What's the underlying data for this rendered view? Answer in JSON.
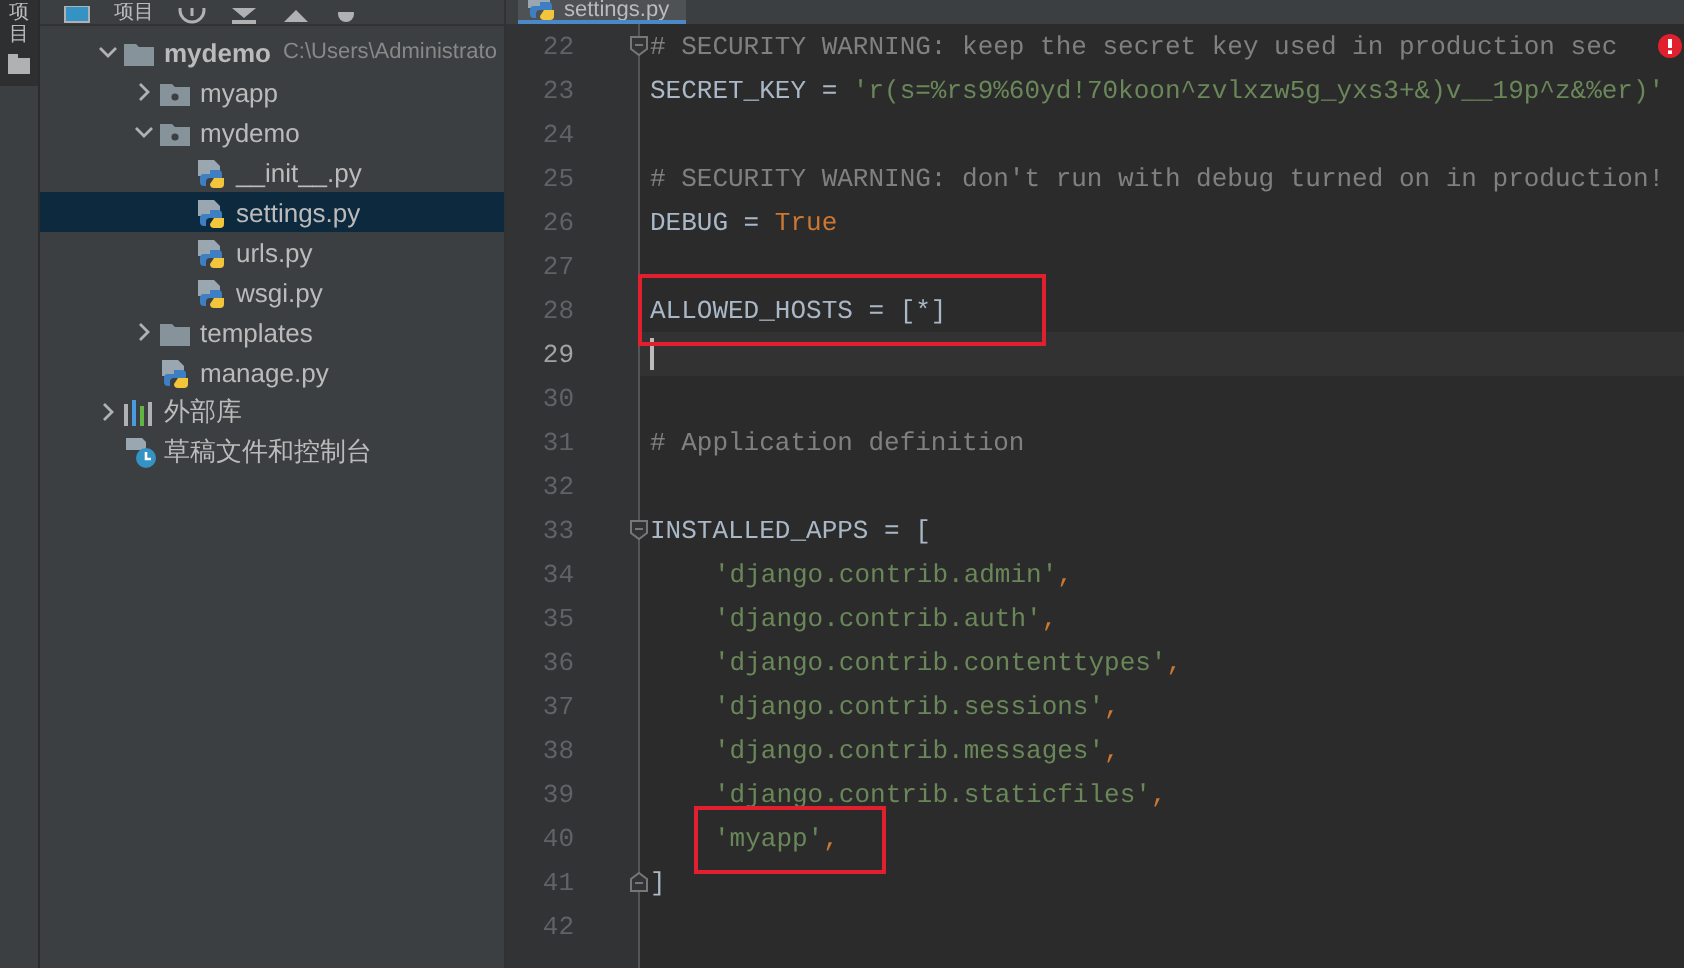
{
  "side_strip": {
    "label": "项目"
  },
  "project_panel": {
    "toolbar": {
      "title": "项目"
    },
    "tree": [
      {
        "label": "mydemo",
        "path": "C:\\Users\\Administrato",
        "kind": "folder",
        "expanded": true,
        "selected": false,
        "children": [
          {
            "label": "myapp",
            "kind": "package",
            "expanded": false,
            "selected": false
          },
          {
            "label": "mydemo",
            "kind": "package",
            "expanded": true,
            "selected": false,
            "children": [
              {
                "label": "__init__.py",
                "kind": "python",
                "selected": false
              },
              {
                "label": "settings.py",
                "kind": "python",
                "selected": true
              },
              {
                "label": "urls.py",
                "kind": "python",
                "selected": false
              },
              {
                "label": "wsgi.py",
                "kind": "python",
                "selected": false
              }
            ]
          },
          {
            "label": "templates",
            "kind": "folder",
            "expanded": false,
            "selected": false
          },
          {
            "label": "manage.py",
            "kind": "python",
            "selected": false
          }
        ]
      },
      {
        "label": "外部库",
        "kind": "library",
        "expanded": false,
        "selected": false
      },
      {
        "label": "草稿文件和控制台",
        "kind": "scratch",
        "selected": false
      }
    ]
  },
  "editor": {
    "tabs": [
      {
        "label": "settings.py",
        "selected": true
      }
    ],
    "lines": [
      {
        "number": "22",
        "fold_open": true,
        "warning": true,
        "tokens": [
          {
            "kind": "comment",
            "text": "# SECURITY WARNING: keep the secret key used in production sec"
          }
        ]
      },
      {
        "number": "23",
        "tokens": [
          {
            "kind": "plain",
            "text": "SECRET_KEY = "
          },
          {
            "kind": "string",
            "text": "'r(s=%rs9%60yd!70koon^zvlxzw5g_yxs3+&)v__19p^z&%er)'"
          }
        ]
      },
      {
        "number": "24"
      },
      {
        "number": "25",
        "tokens": [
          {
            "kind": "comment",
            "text": "# SECURITY WARNING: don't run with debug turned on in production!"
          }
        ]
      },
      {
        "number": "26",
        "tokens": [
          {
            "kind": "plain",
            "text": "DEBUG = "
          },
          {
            "kind": "keyword",
            "text": "True"
          }
        ]
      },
      {
        "number": "27"
      },
      {
        "number": "28",
        "boxed": true,
        "tokens": [
          {
            "kind": "plain",
            "text": "ALLOWED_HOSTS = [*]"
          }
        ]
      },
      {
        "number": "29",
        "current": true
      },
      {
        "number": "30"
      },
      {
        "number": "31",
        "tokens": [
          {
            "kind": "comment",
            "text": "# Application definition"
          }
        ]
      },
      {
        "number": "32"
      },
      {
        "number": "33",
        "fold_open": true,
        "tokens": [
          {
            "kind": "plain",
            "text": "INSTALLED_APPS = ["
          }
        ]
      },
      {
        "number": "34",
        "indented": true,
        "tokens": [
          {
            "kind": "string",
            "text": "'django.contrib.admin'"
          },
          {
            "kind": "punct",
            "text": ","
          }
        ]
      },
      {
        "number": "35",
        "indented": true,
        "tokens": [
          {
            "kind": "string",
            "text": "'django.contrib.auth'"
          },
          {
            "kind": "punct",
            "text": ","
          }
        ]
      },
      {
        "number": "36",
        "indented": true,
        "tokens": [
          {
            "kind": "string",
            "text": "'django.contrib.contenttypes'"
          },
          {
            "kind": "punct",
            "text": ","
          }
        ]
      },
      {
        "number": "37",
        "indented": true,
        "tokens": [
          {
            "kind": "string",
            "text": "'django.contrib.sessions'"
          },
          {
            "kind": "punct",
            "text": ","
          }
        ]
      },
      {
        "number": "38",
        "indented": true,
        "tokens": [
          {
            "kind": "string",
            "text": "'django.contrib.messages'"
          },
          {
            "kind": "punct",
            "text": ","
          }
        ]
      },
      {
        "number": "39",
        "indented": true,
        "tokens": [
          {
            "kind": "string",
            "text": "'django.contrib.staticfiles'"
          },
          {
            "kind": "punct",
            "text": ","
          }
        ]
      },
      {
        "number": "40",
        "indented": true,
        "boxed": true,
        "tokens": [
          {
            "kind": "string",
            "text": "'myapp'"
          },
          {
            "kind": "punct",
            "text": ","
          }
        ]
      },
      {
        "number": "41",
        "fold_close": true,
        "tokens": [
          {
            "kind": "plain",
            "text": "]"
          }
        ]
      },
      {
        "number": "42"
      }
    ]
  }
}
